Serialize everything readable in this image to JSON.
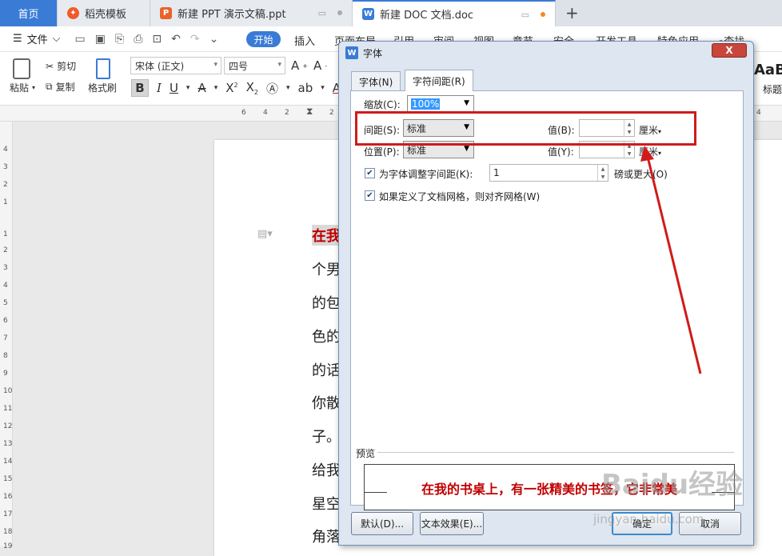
{
  "tabs": {
    "home": "首页",
    "daoke": "稻壳模板",
    "ppt": "新建 PPT 演示文稿.ppt",
    "doc": "新建 DOC 文档.doc"
  },
  "menu": {
    "file": "文件",
    "start": "开始",
    "insert": "插入",
    "layout": "页面布局",
    "reference": "引用",
    "review": "审阅",
    "view": "视图",
    "section": "章节",
    "security": "安全",
    "dev": "开发工具",
    "special": "特色应用",
    "search": "查找"
  },
  "ribbon": {
    "paste": "粘贴",
    "cut": "剪切",
    "copy": "复制",
    "format_painter": "格式刷",
    "font_name": "宋体 (正文)",
    "font_size": "四号",
    "style_sample": "AaB",
    "style_label": "标题"
  },
  "ruler": {
    "h": [
      "6",
      "4",
      "2",
      "2",
      "4"
    ],
    "v": [
      "4",
      "3",
      "2",
      "1",
      "1",
      "2",
      "3",
      "4",
      "5",
      "6",
      "7",
      "8",
      "9",
      "10",
      "11",
      "12",
      "13",
      "14",
      "15",
      "16",
      "17",
      "18",
      "19"
    ]
  },
  "document": {
    "lines": [
      "在我",
      "个男",
      "的包",
      "色的",
      "的话",
      "你散",
      "子。",
      "给我",
      "星空",
      "角落"
    ]
  },
  "dialog": {
    "title": "字体",
    "close": "X",
    "tab_font": "字体(N)",
    "tab_spacing": "字符间距(R)",
    "scale_label": "缩放(C):",
    "scale_value": "100%",
    "spacing_label": "间距(S):",
    "spacing_value": "标准",
    "spacing_by_label": "值(B):",
    "spacing_by_value": "",
    "spacing_unit": "厘米",
    "position_label": "位置(P):",
    "position_value": "标准",
    "position_by_label": "值(Y):",
    "position_by_value": "",
    "position_unit": "厘米",
    "kerning_label": "为字体调整字间距(K):",
    "kerning_value": "1",
    "kerning_suffix": "磅或更大(O)",
    "grid_label": "如果定义了文档网格，则对齐网格(W)",
    "preview_label": "预览",
    "preview_text": "在我的书桌上，有一张精美的书签，它非常美",
    "btn_default": "默认(D)...",
    "btn_effects": "文本效果(E)...",
    "btn_ok": "确定",
    "btn_cancel": "取消"
  },
  "watermark": {
    "main": "Baidu经验",
    "sub": "jingyan.baidu.com"
  },
  "colors": {
    "accent": "#3a7bd5",
    "annotation": "#d11a1a",
    "preview_text": "#c00000"
  }
}
